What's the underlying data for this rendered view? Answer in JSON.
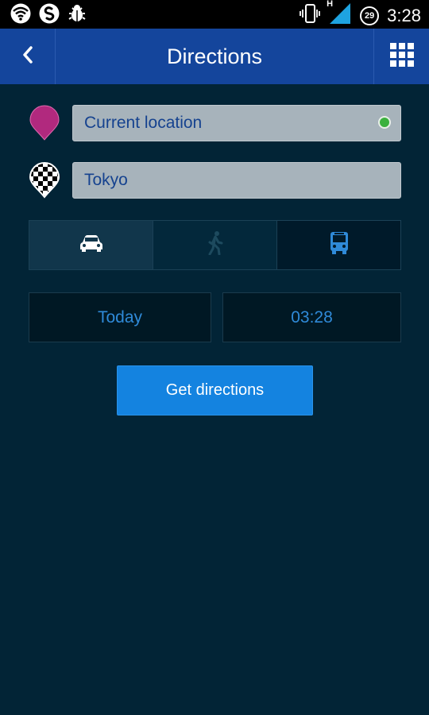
{
  "status_bar": {
    "time": "3:28",
    "notification_count": "29",
    "network_label": "H",
    "icons": [
      "wifi-icon",
      "shazam-icon",
      "bug-icon",
      "vibrate-icon",
      "signal-icon"
    ]
  },
  "header": {
    "title": "Directions",
    "back_icon": "chevron-left-icon",
    "menu_icon": "grid-menu-icon",
    "background": "#14459c"
  },
  "origin": {
    "value": "Current location",
    "icon": "origin-pin-icon",
    "pin_color": "#b1297e",
    "status_color": "#3bb13e"
  },
  "destination": {
    "value": "Tokyo",
    "icon": "checkered-flag-pin-icon"
  },
  "transport_modes": [
    {
      "name": "car",
      "icon": "car-icon",
      "selected": true
    },
    {
      "name": "walk",
      "icon": "walk-icon",
      "selected": false
    },
    {
      "name": "transit",
      "icon": "bus-icon",
      "selected": false
    }
  ],
  "departure": {
    "date": "Today",
    "time": "03:28"
  },
  "actions": {
    "get_directions_label": "Get directions",
    "accent": "#1483e0"
  }
}
